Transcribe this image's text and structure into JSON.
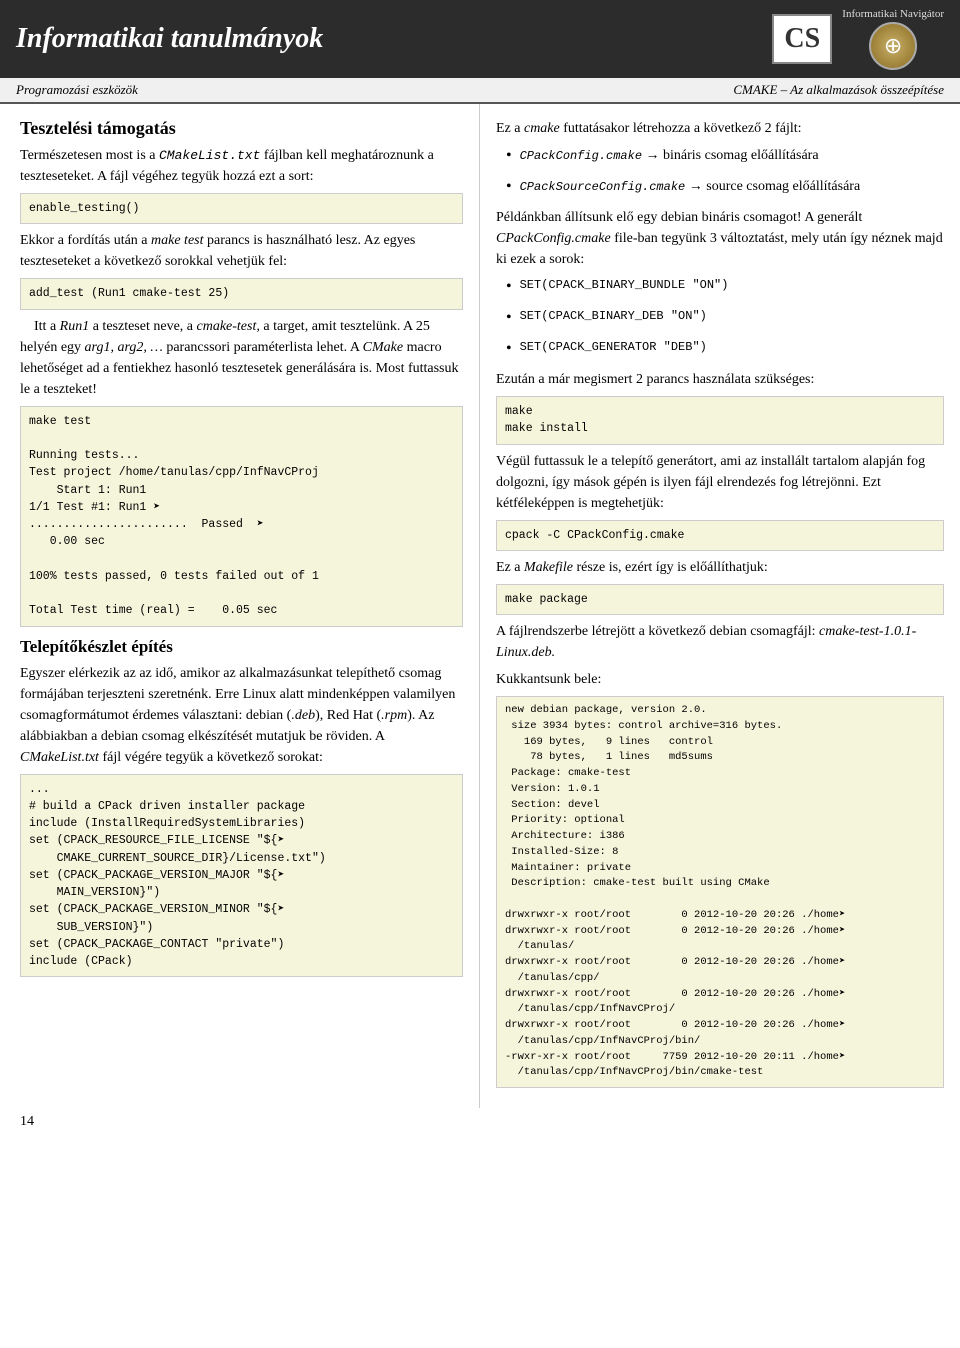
{
  "header": {
    "title": "Informatikai tanulmányok",
    "nav_label": "Informatikai Navigátor",
    "cs_logo": "CS"
  },
  "subheader": {
    "left": "Programozási eszközök",
    "right": "CMAKE – Az alkalmazások összeépítése"
  },
  "left": {
    "section1_title": "Tesztelési támogatás",
    "para1": "Természetesen most is a CMakeList.txt fájlban kell meghatároznunk a teszteseteket. A fájl végéhez tegyük hozzá ezt a sort:",
    "code1": "enable_testing()",
    "para2": "Ekkor a fordítás után a make test parancs is használható lesz. Az egyes teszteseteket a következő sorokkal vehetjük fel:",
    "code2": "add_test (Run1 cmake-test 25)",
    "para3_a": "Itt a ",
    "para3_b": "Run1",
    "para3_c": " a teszteset neve, a ",
    "para3_d": "cmake-test,",
    "para3_e": " a target, amit tesztelünk. A 25 helyén egy ",
    "para3_f": "arg1, arg2, …",
    "para3_g": " parancssori paraméterlista lehet. A CMake macro lehetőséget ad a fentiekhez hasonló tesztesetek generálására is. Most futtassuk le a teszteket!",
    "code3": "make test\n\nRunning tests...\nTest project /home/tanulas/cpp/InfNavCProj\n    Start 1: Run1\n1/1 Test #1: Run1 ➜\n.......................  Passed  ➜\n   0.00 sec\n\n100% tests passed, 0 tests failed out of 1\n\nTotal Test time (real) =    0.05 sec",
    "section2_title": "Telepítőkészlet építés",
    "para4": "Egyszer elérkezik az az idő, amikor az alkalmazásunkat telepíthető csomag formájában terjeszteni szeretnénk. Erre Linux alatt mindenképpen valamilyen csomagformátumot érdemes választani: debian (.deb), Red Hat (.rpm). Az alábbiakban a debian csomag elkészítését mutatjuk be röviden. A CMakeList.txt fájl végére tegyük a következő sorokat:",
    "code4": "...\n# build a CPack driven installer package\ninclude (InstallRequiredSystemLibraries)\nset (CPACK_RESOURCE_FILE_LICENSE \"${→\n    CMAKE_CURRENT_SOURCE_DIR}/License.txt\")\nset (CPACK_PACKAGE_VERSION_MAJOR \"${→\n    MAIN_VERSION}\")\nset (CPACK_PACKAGE_VERSION_MINOR \"${→\n    SUB_VERSION}\")\nset (CPACK_PACKAGE_CONTACT \"private\")\ninclude (CPack)"
  },
  "right": {
    "para1": "Ez a cmake futtatásakor létrehozza a következő 2 fájlt:",
    "bullets1": [
      {
        "code": "CPackConfig.cmake",
        "text": " → bináris csomag előállítására"
      },
      {
        "code": "CPackSourceConfig.cmake",
        "text": " → source csomag előállítására"
      }
    ],
    "para2": "Példánkban állítsunk elő egy debian bináris csomagot! A generált CPackConfig.cmake file-ban tegyünk 3 változtatást, mely után így néznek majd ki ezek a sorok:",
    "bullets2": [
      {
        "code": "SET(CPACK_BINARY_BUNDLE \"ON\")"
      },
      {
        "code": "SET(CPACK_BINARY_DEB \"ON\")"
      },
      {
        "code": "SET(CPACK_GENERATOR \"DEB\")"
      }
    ],
    "para3": "Ezután a már megismert 2 parancs használata szükséges:",
    "code5": "make\nmake install",
    "para4": "Végül futtassuk le a telepítő generátort, ami az installált tartalom alapján fog dolgozni, így mások gépén is ilyen fájl elrendezés fog létrejönni. Ezt kétféleképpen is megtehetjük:",
    "code6": "cpack -C CPackConfig.cmake",
    "para5": "Ez a Makefile része is, ezért így is előállíthatjuk:",
    "code7": "make package",
    "para6": "A fájlrendszerbe létrejött a következő debian csomagfájl: cmake-test-1.0.1-Linux.deb.",
    "para6b": "Kukkantsunk bele:",
    "code8": "new debian package, version 2.0.\n size 3934 bytes: control archive=316 bytes.\n   169 bytes,   9 lines   control\n    78 bytes,   1 lines   md5sums\n Package: cmake-test\n Version: 1.0.1\n Section: devel\n Priority: optional\n Architecture: i386\n Installed-Size: 8\n Maintainer: private\n Description: cmake-test built using CMake\n\ndrwxrwxr-x root/root        0 2012-10-20 20:26 ./home➜\ndrwxrwxr-x root/root        0 2012-10-20 20:26 ./home➜\n  /tanulas/\ndrwxrwxr-x root/root        0 2012-10-20 20:26 ./home➜\n  /tanulas/cpp/\ndrwxrwxr-x root/root        0 2012-10-20 20:26 ./home➜\n  /tanulas/cpp/InfNavCProj/\ndrwxrwxr-x root/root        0 2012-10-20 20:26 ./home➜\n  /tanulas/cpp/InfNavCProj/bin/\n-rwxr-xr-x root/root     7759 2012-10-20 20:11 ./home➜\n  /tanulas/cpp/InfNavCProj/bin/cmake-test"
  },
  "page_number": "14"
}
